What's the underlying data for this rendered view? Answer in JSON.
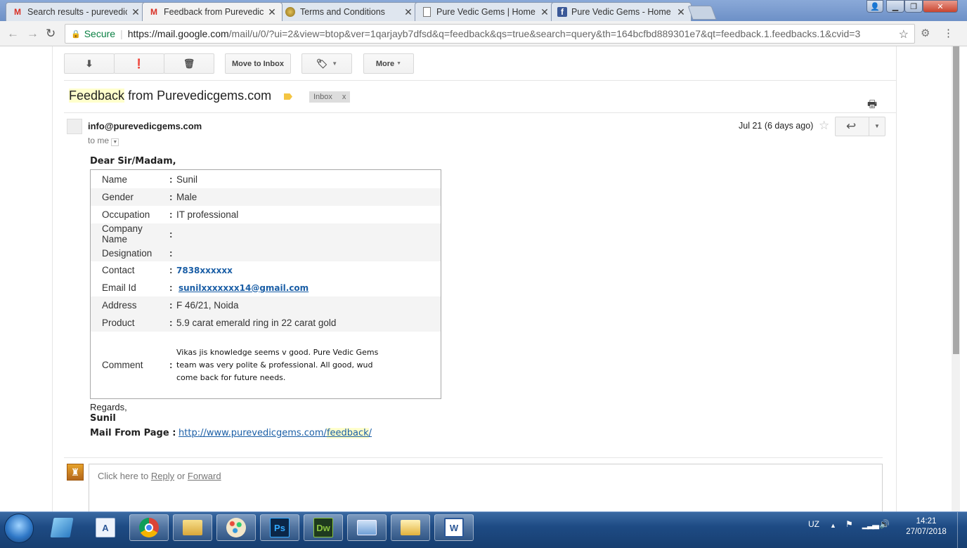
{
  "browser": {
    "tabs": [
      {
        "title": "Search results - purevedic",
        "icon": "gmail-icon"
      },
      {
        "title": "Feedback from Purevedic",
        "icon": "gmail-icon"
      },
      {
        "title": "Terms and Conditions",
        "icon": "site-icon"
      },
      {
        "title": "Pure Vedic Gems | Home",
        "icon": "page-icon"
      },
      {
        "title": "Pure Vedic Gems - Home",
        "icon": "facebook-icon"
      }
    ],
    "active_tab": 1,
    "address": {
      "secure_label": "Secure",
      "host": "https://mail.google.com",
      "path": "/mail/u/0/?ui=2&view=btop&ver=1qarjayb7dfsd&q=feedback&qs=true&search=query&th=164bcfbd889301e7&qt=feedback.1.feedbacks.1&cvid=3"
    }
  },
  "toolbar": {
    "move_to_inbox": "Move to Inbox",
    "more": "More"
  },
  "message": {
    "subject_highlight": "Feedback",
    "subject_rest": " from Purevedicgems.com",
    "label": "Inbox",
    "label_close": "x",
    "sender": "info@purevedicgems.com",
    "to": "to me",
    "date": "Jul 21 (6 days ago)"
  },
  "body": {
    "greeting": "Dear Sir/Madam,",
    "fields": [
      {
        "label": "Name",
        "value": "Sunil"
      },
      {
        "label": "Gender",
        "value": "Male"
      },
      {
        "label": "Occupation",
        "value": "IT professional"
      },
      {
        "label": "Company Name",
        "value": ""
      },
      {
        "label": "Designation",
        "value": ""
      },
      {
        "label": "Contact",
        "value": "7838xxxxxx"
      },
      {
        "label": "Email Id",
        "value": "sunilxxxxxxx14@gmail.com"
      },
      {
        "label": "Address",
        "value": "F 46/21, Noida"
      },
      {
        "label": "Product",
        "value": "5.9 carat emerald ring in 22 carat gold"
      },
      {
        "label": "Comment",
        "value": "Vikas jis knowledge seems v good. Pure Vedic Gems team was very polite & professional. All good, wud come back for future needs."
      }
    ],
    "colon": ":",
    "regards": "Regards,",
    "signature": "Sunil",
    "mail_from_label": "Mail From Page :",
    "mail_from_url_start": "http://www.purevedicgems.com/",
    "mail_from_url_highlight": "feedback",
    "mail_from_url_end": "/"
  },
  "reply": {
    "prefix": "Click here to ",
    "reply": "Reply",
    "or": " or ",
    "forward": "Forward"
  },
  "taskbar": {
    "apps": [
      "ie-icon",
      "text-editor-icon",
      "chrome-icon",
      "explorer-icon",
      "paint-icon",
      "photoshop-icon",
      "dreamweaver-icon",
      "network-icon",
      "outlook-icon",
      "word-icon"
    ],
    "photoshop": "Ps",
    "dreamweaver": "Dw",
    "word": "W",
    "lang": "UZ",
    "time": "14:21",
    "date": "27/07/2018"
  }
}
